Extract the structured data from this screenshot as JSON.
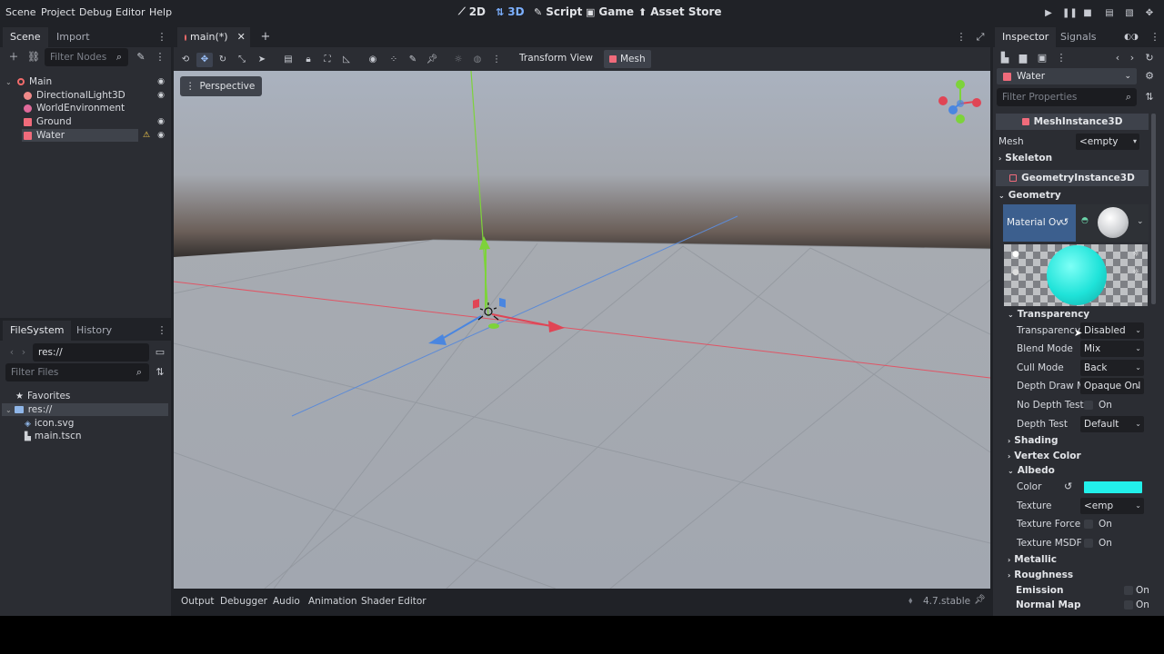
{
  "menubar": {
    "menus": [
      "Scene",
      "Project",
      "Debug",
      "Editor",
      "Help"
    ],
    "workspaces": [
      {
        "label": "2D",
        "icon": "2d-icon"
      },
      {
        "label": "3D",
        "icon": "3d-icon",
        "active": true
      },
      {
        "label": "Script",
        "icon": "script-icon"
      },
      {
        "label": "Game",
        "icon": "game-icon"
      },
      {
        "label": "Asset Store",
        "icon": "asset-store-icon"
      }
    ]
  },
  "scene_dock": {
    "tabs": [
      "Scene",
      "Import"
    ],
    "filter_placeholder": "Filter Nodes",
    "nodes": [
      {
        "label": "Main",
        "icon": "node3d-icon"
      },
      {
        "label": "DirectionalLight3D",
        "icon": "light-icon"
      },
      {
        "label": "WorldEnvironment",
        "icon": "environment-icon"
      },
      {
        "label": "Ground",
        "icon": "mesh-icon"
      },
      {
        "label": "Water",
        "icon": "mesh-icon",
        "selected": true
      }
    ]
  },
  "filesystem_dock": {
    "tabs": [
      "FileSystem",
      "History"
    ],
    "path": "res://",
    "filter_placeholder": "Filter Files",
    "items": [
      "Favorites",
      "res://",
      "icon.svg",
      "main.tscn"
    ]
  },
  "editor": {
    "scene_tab": "main(*)",
    "toolbar": {
      "transform": "Transform",
      "view": "View",
      "mesh": "Mesh"
    },
    "perspective": "Perspective"
  },
  "bottom_panel": {
    "tabs": [
      "Output",
      "Debugger",
      "Audio",
      "Animation",
      "Shader Editor"
    ],
    "version": "4.7.stable"
  },
  "inspector": {
    "tabs": [
      "Inspector",
      "Signals"
    ],
    "node_name": "Water",
    "filter_placeholder": "Filter Properties",
    "class_meshinstance": "MeshInstance3D",
    "mesh_label": "Mesh",
    "mesh_value": "<empty",
    "skeleton": "Skeleton",
    "class_geometry": "GeometryInstance3D",
    "geometry": "Geometry",
    "material_label": "Material Ov",
    "transparency_section": "Transparency",
    "props": [
      {
        "label": "Transparency",
        "value": "Disabled"
      },
      {
        "label": "Blend Mode",
        "value": "Mix"
      },
      {
        "label": "Cull Mode",
        "value": "Back"
      },
      {
        "label": "Depth Draw M",
        "value": "Opaque Onl"
      }
    ],
    "no_depth_test": {
      "label": "No Depth Test",
      "value": "On"
    },
    "depth_test": {
      "label": "Depth Test",
      "value": "Default"
    },
    "shading": "Shading",
    "vertex_color": "Vertex Color",
    "albedo": "Albedo",
    "albedo_color_label": "Color",
    "albedo_color": "#22f0ea",
    "texture": {
      "label": "Texture",
      "value": "<emp"
    },
    "texture_force": {
      "label": "Texture Force",
      "value": "On"
    },
    "texture_msdf": {
      "label": "Texture MSDF",
      "value": "On"
    },
    "metallic": "Metallic",
    "roughness": "Roughness",
    "emission": {
      "label": "Emission",
      "value": "On"
    },
    "normal_map": {
      "label": "Normal Map",
      "value": "On"
    }
  }
}
